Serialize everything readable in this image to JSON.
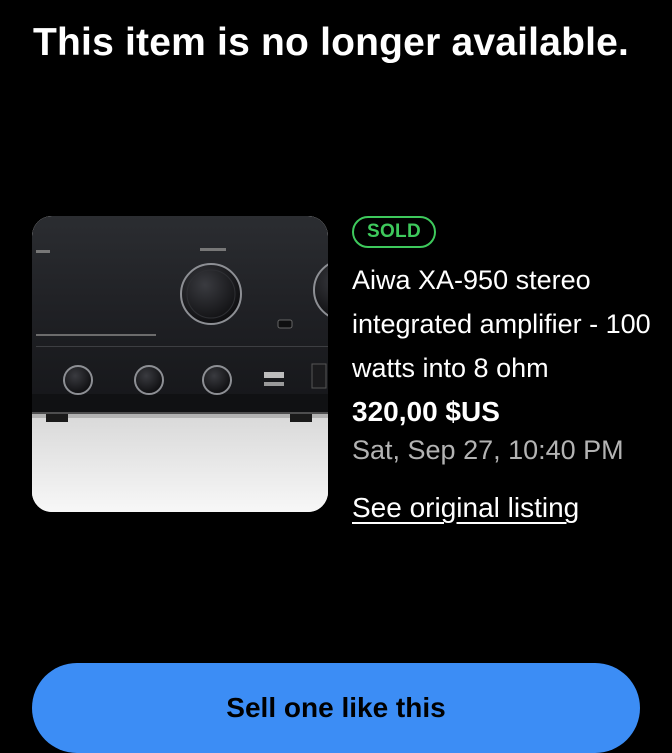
{
  "page": {
    "headline": "This item is no longer available."
  },
  "listing": {
    "badge": "SOLD",
    "title": "Aiwa XA-950 stereo integrated amplifier - 100 watts into 8 ohm",
    "price": "320,00 $US",
    "sold_date": "Sat, Sep 27, 10:40 PM",
    "link_label": "See original listing",
    "image_subject": "black stereo amplifier front panel"
  },
  "actions": {
    "primary_button_label": "Sell one like this"
  },
  "colors": {
    "background": "#000000",
    "sold_badge": "#3ec95c",
    "primary_button": "#3c8df5",
    "muted_text": "#b3b3b3"
  }
}
